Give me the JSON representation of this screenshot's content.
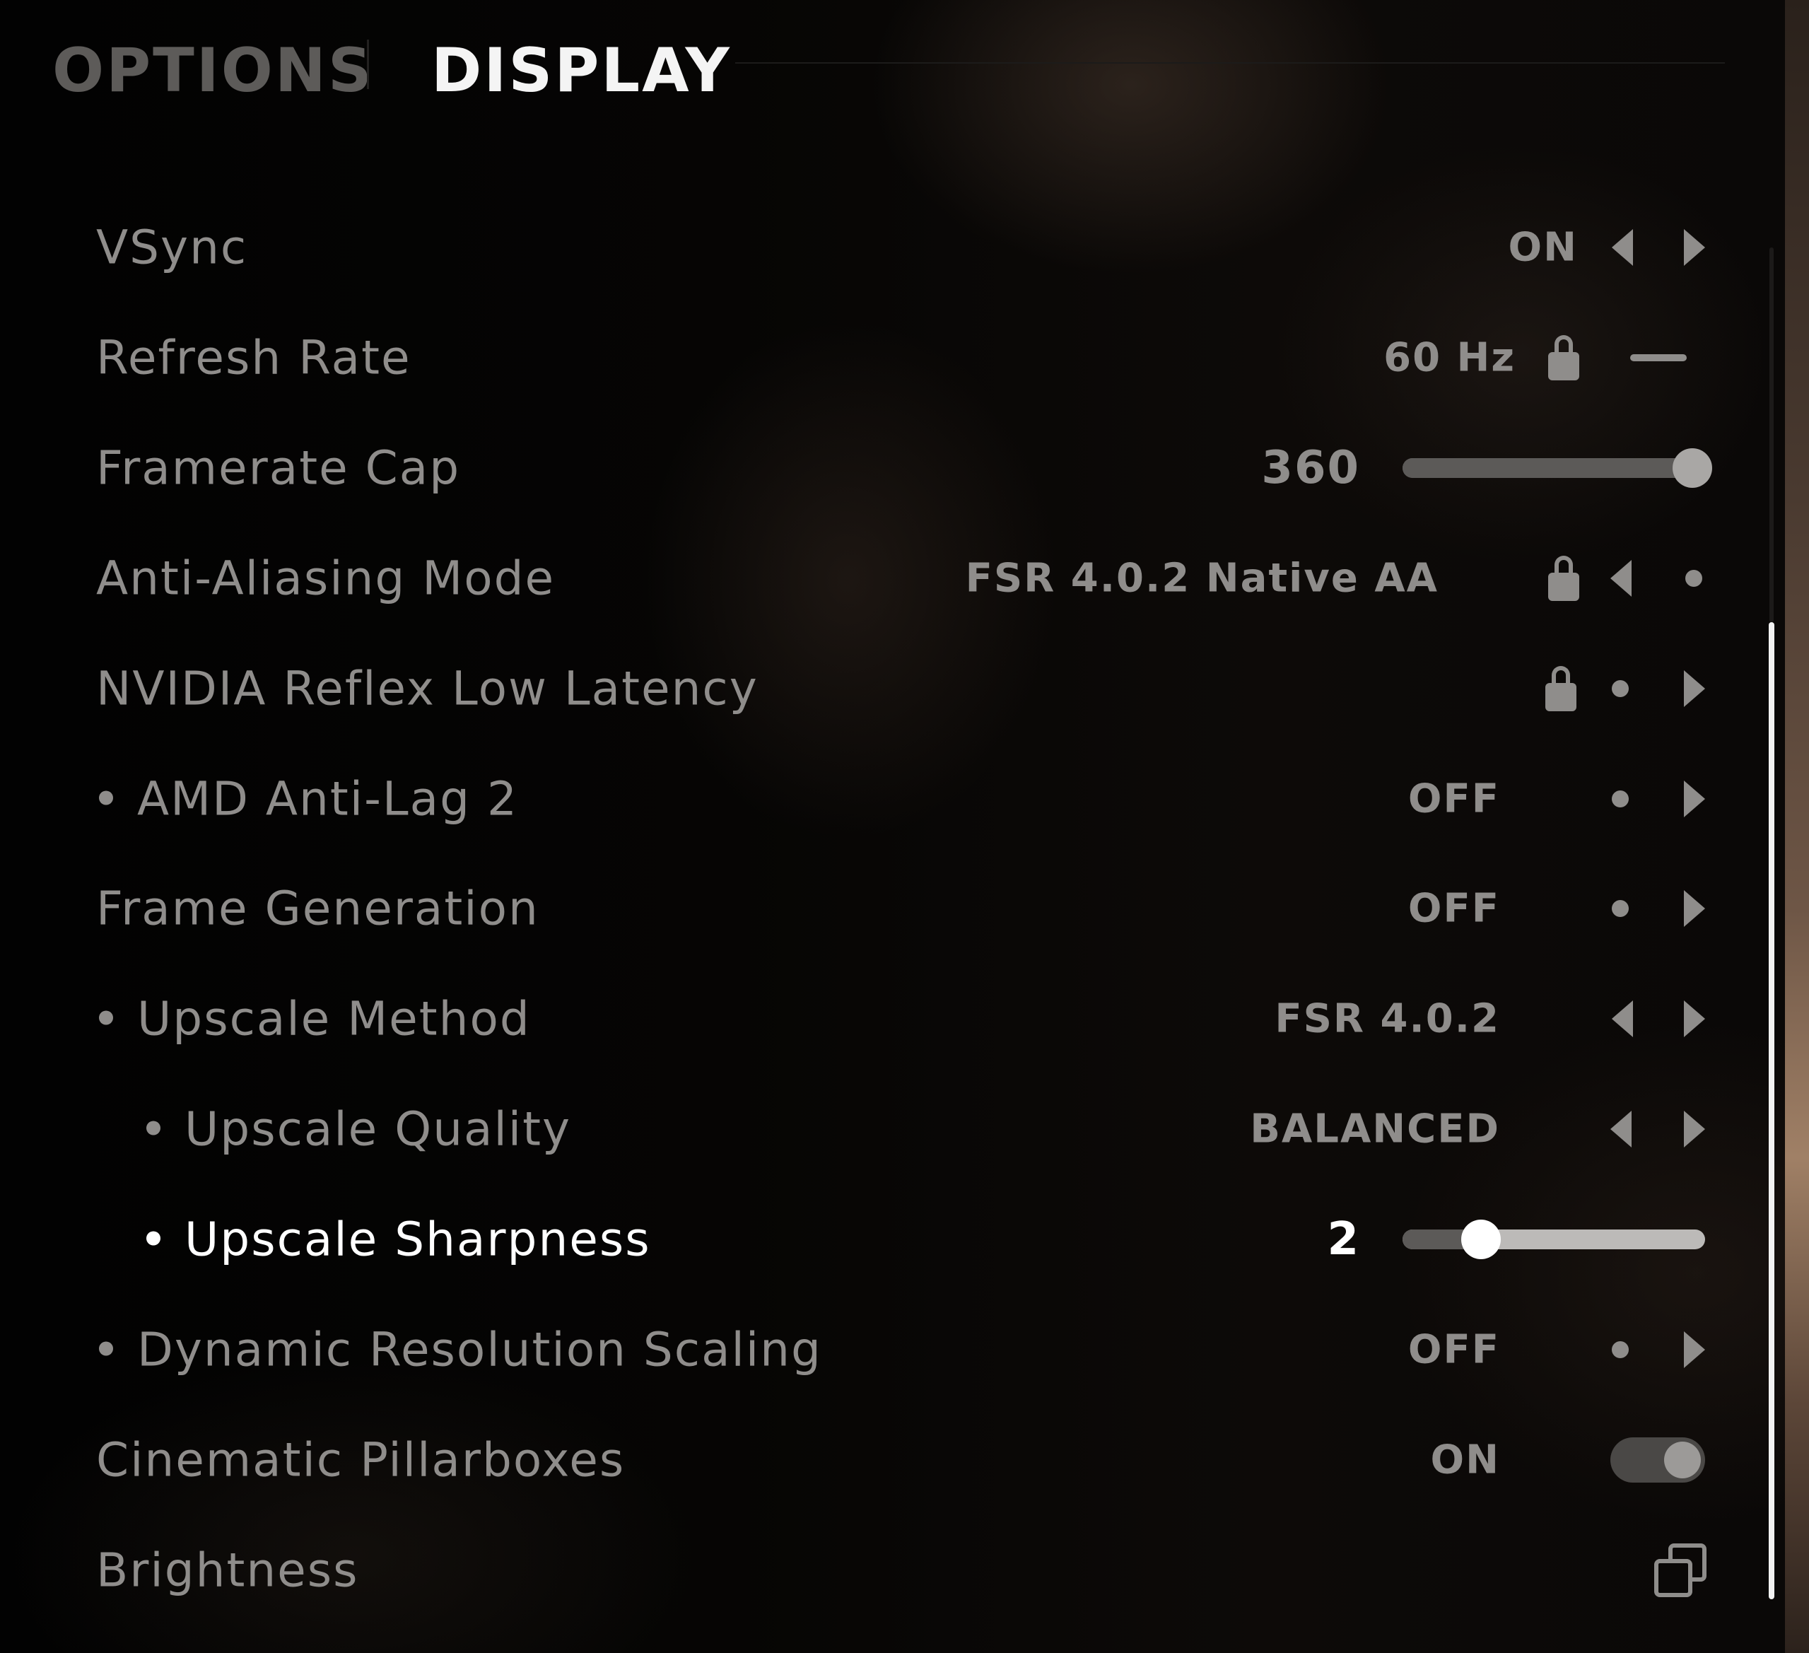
{
  "header": {
    "tab_options": "OPTIONS",
    "tab_display": "DISPLAY"
  },
  "settings": [
    {
      "label": "VSync",
      "value": "ON"
    },
    {
      "label": "Refresh Rate",
      "value": "60 Hz"
    },
    {
      "label": "Framerate Cap",
      "value": "360",
      "slider_fraction": 1.0
    },
    {
      "label": "Anti-Aliasing Mode",
      "value": "FSR 4.0.2 Native AA"
    },
    {
      "label": "NVIDIA Reflex Low Latency",
      "value": ""
    },
    {
      "label": "AMD Anti-Lag 2",
      "value": "OFF"
    },
    {
      "label": "Frame Generation",
      "value": "OFF"
    },
    {
      "label": "Upscale Method",
      "value": "FSR 4.0.2"
    },
    {
      "label": "Upscale Quality",
      "value": "BALANCED"
    },
    {
      "label": "Upscale Sharpness",
      "value": "2",
      "slider_fraction": 0.26
    },
    {
      "label": "Dynamic Resolution Scaling",
      "value": "OFF"
    },
    {
      "label": "Cinematic Pillarboxes",
      "value": "ON"
    },
    {
      "label": "Brightness",
      "value": ""
    }
  ],
  "icons": {
    "prev": "arrow-left-icon",
    "next": "arrow-right-icon",
    "locked": "lock-icon",
    "unavailable": "dot-icon",
    "sub_page": "copy-icon"
  },
  "colors": {
    "active_text": "#ffffff",
    "inactive_text": "#8f8d8b",
    "tab_inactive": "#5d5b59"
  }
}
